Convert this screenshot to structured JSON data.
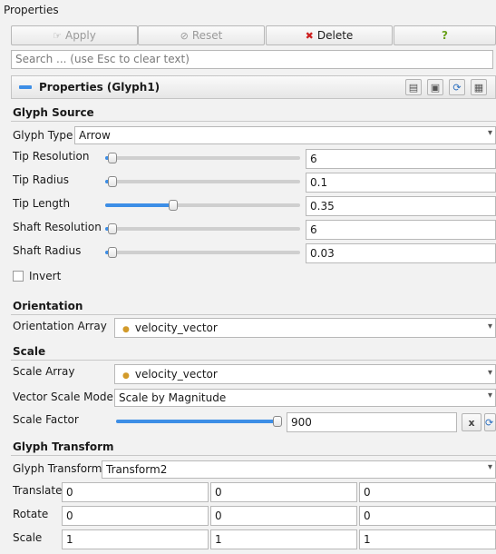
{
  "panel": {
    "title": "Properties",
    "buttons": {
      "apply": "Apply",
      "reset": "Reset",
      "delete": "Delete",
      "help": "?"
    },
    "search_placeholder": "Search ... (use Esc to clear text)",
    "header_title": "Properties (Glyph1)",
    "colors": {
      "accent": "#3d8ee6",
      "delete_icon": "#cc1f1f",
      "help": "#6aa11c",
      "dot": "#d29a2a"
    }
  },
  "glyph_source": {
    "section": "Glyph Source",
    "glyph_type_label": "Glyph Type",
    "glyph_type_value": "Arrow",
    "rows": [
      {
        "label": "Tip Resolution",
        "value": "6",
        "slider_fraction": 0.03
      },
      {
        "label": "Tip Radius",
        "value": "0.1",
        "slider_fraction": 0.0
      },
      {
        "label": "Tip Length",
        "value": "0.35",
        "slider_fraction": 0.35
      },
      {
        "label": "Shaft Resolution",
        "value": "6",
        "slider_fraction": 0.03
      },
      {
        "label": "Shaft Radius",
        "value": "0.03",
        "slider_fraction": 0.0
      }
    ],
    "invert_label": "Invert",
    "invert_checked": false
  },
  "orientation": {
    "section": "Orientation",
    "array_label": "Orientation Array",
    "array_value": "velocity_vector"
  },
  "scale": {
    "section": "Scale",
    "array_label": "Scale Array",
    "array_value": "velocity_vector",
    "mode_label": "Vector Scale Mode",
    "mode_value": "Scale by Magnitude",
    "factor_label": "Scale Factor",
    "factor_value": "900",
    "factor_slider_fraction": 1.0,
    "factor_btn": "x"
  },
  "glyph_transform": {
    "section": "Glyph Transform",
    "transform_label": "Glyph Transform",
    "transform_value": "Transform2",
    "translate_label": "Translate",
    "translate": [
      "0",
      "0",
      "0"
    ],
    "rotate_label": "Rotate",
    "rotate": [
      "0",
      "0",
      "0"
    ],
    "scale_label": "Scale",
    "scale": [
      "1",
      "1",
      "1"
    ]
  }
}
